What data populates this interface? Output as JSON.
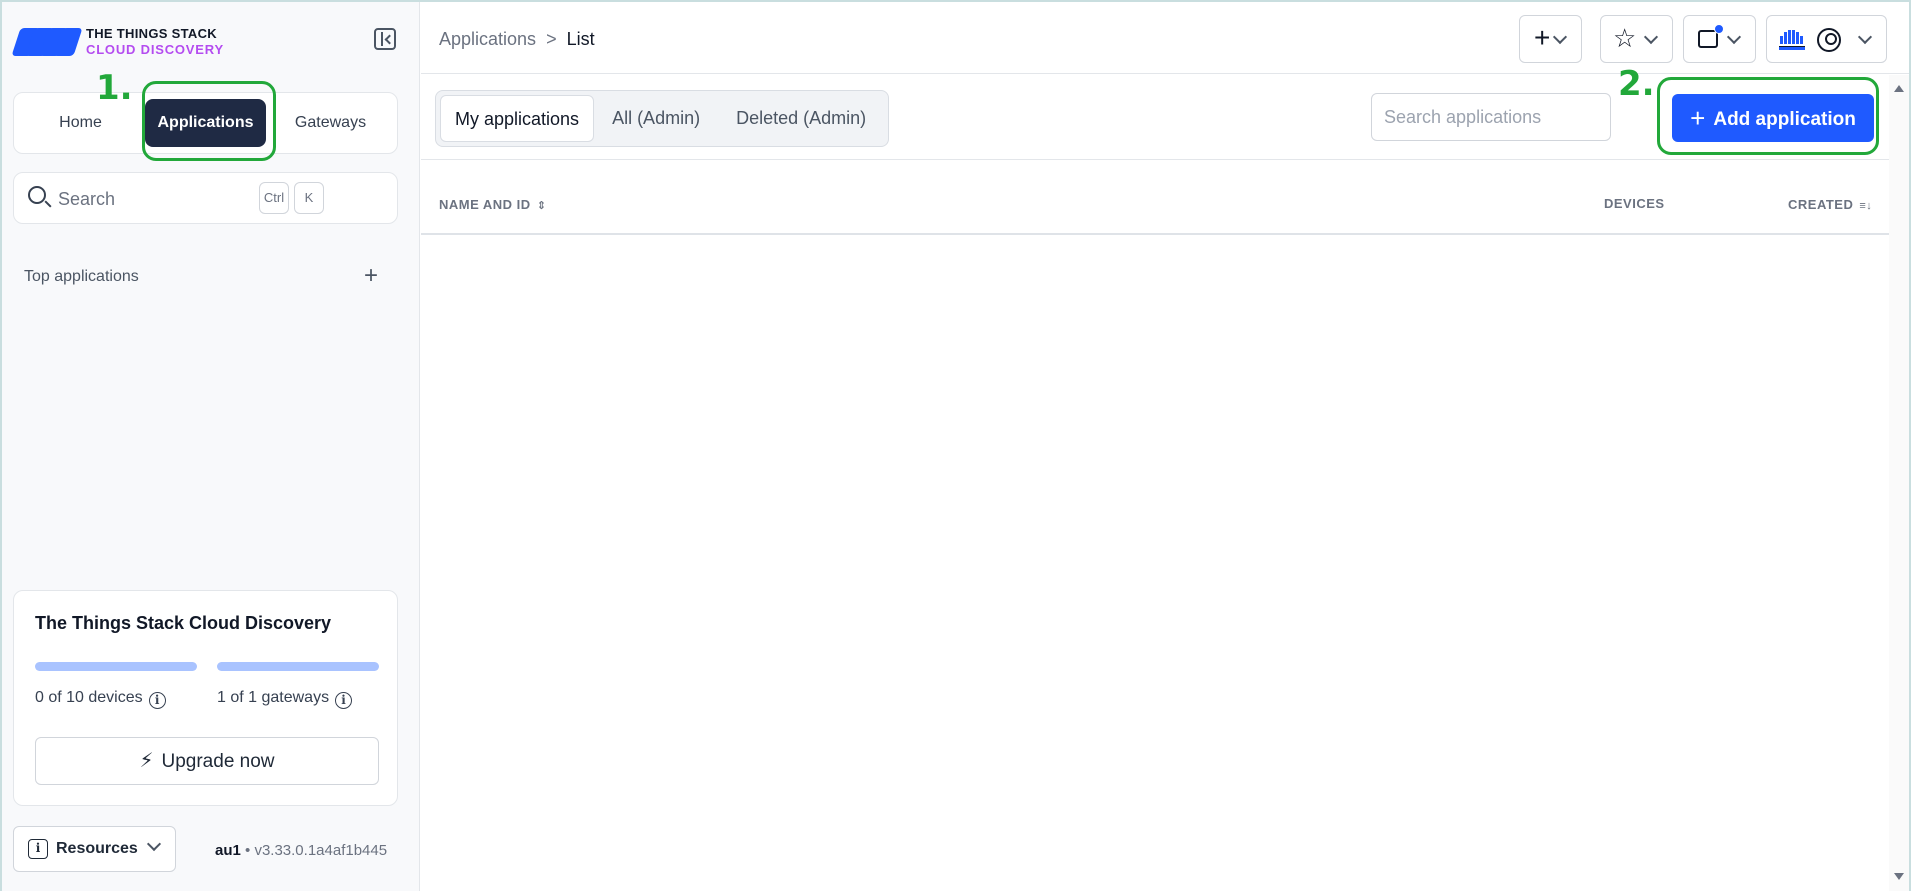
{
  "brand": {
    "line1": "THE THINGS STACK",
    "line2": "CLOUD DISCOVERY",
    "accent": "#1f5aff",
    "subaccent": "#b44cf0"
  },
  "sidebar": {
    "nav": [
      {
        "label": "Home"
      },
      {
        "label": "Applications",
        "active": true
      },
      {
        "label": "Gateways"
      }
    ],
    "search": {
      "placeholder": "Search",
      "kbd1": "Ctrl",
      "kbd2": "K"
    },
    "top_apps_label": "Top applications",
    "plan": {
      "title": "The Things Stack Cloud Discovery",
      "devices_label": "0 of 10 devices",
      "gateways_label": "1 of 1 gateways",
      "devices_used": 0,
      "devices_limit": 10,
      "gateways_used": 1,
      "gateways_limit": 1,
      "upgrade_label": "Upgrade now"
    },
    "resources_label": "Resources",
    "version": {
      "cluster": "au1",
      "build": "• v3.33.0.1a4af1b445"
    }
  },
  "annotations": {
    "step1": "1.",
    "step2": "2.",
    "color": "#22a83a"
  },
  "topbar": {
    "breadcrumb": {
      "parent": "Applications",
      "separator": ">",
      "current": "List"
    }
  },
  "main": {
    "tabs": [
      {
        "label": "My applications",
        "active": true
      },
      {
        "label": "All (Admin)"
      },
      {
        "label": "Deleted (Admin)"
      }
    ],
    "search_placeholder": "Search applications",
    "add_button": "Add application",
    "columns": {
      "name": "NAME AND ID",
      "devices": "DEVICES",
      "created": "CREATED"
    }
  }
}
